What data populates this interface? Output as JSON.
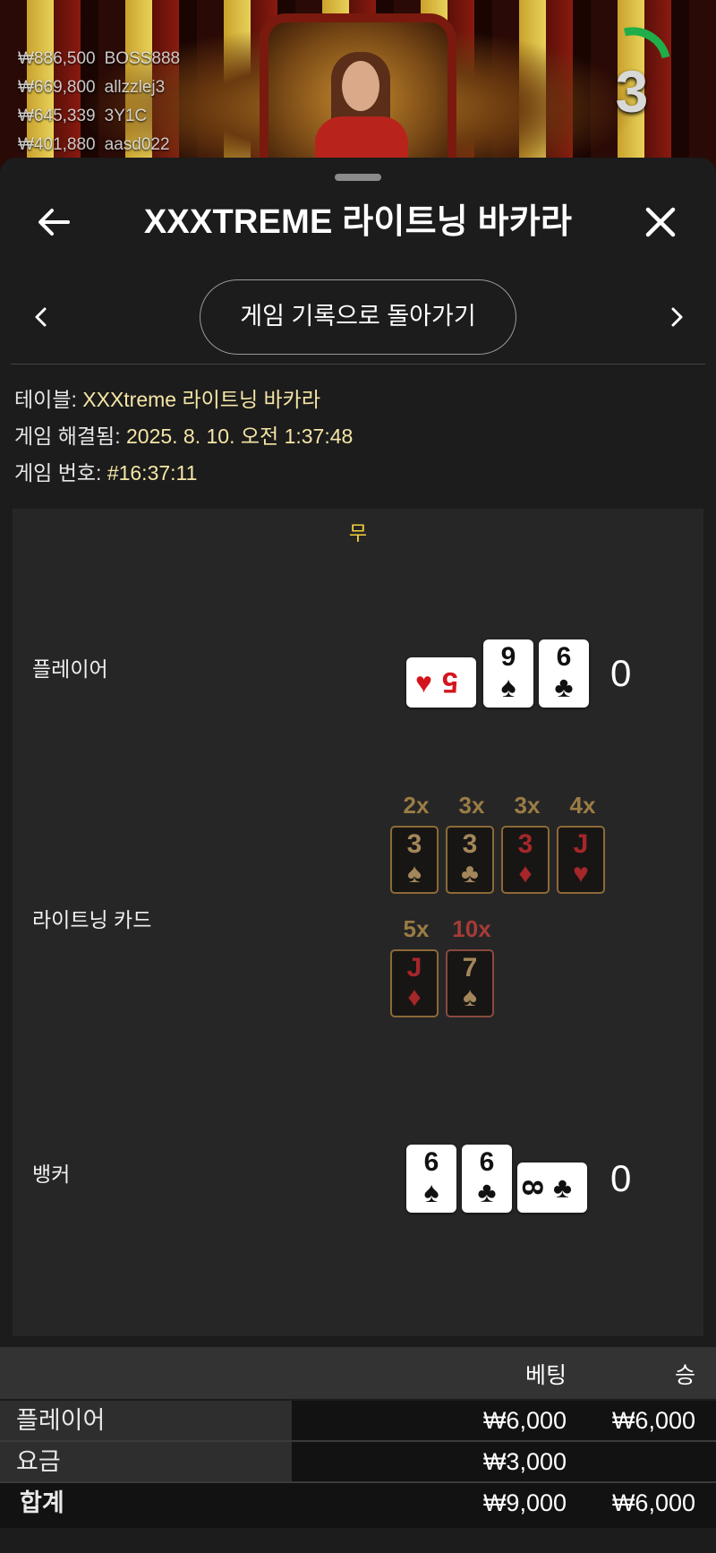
{
  "live_feed": {
    "winners": [
      {
        "amount": "₩886,500",
        "user": "BOSS888"
      },
      {
        "amount": "₩669,800",
        "user": "allzzlej3"
      },
      {
        "amount": "₩645,339",
        "user": "3Y1C"
      },
      {
        "amount": "₩401,880",
        "user": "aasd022"
      }
    ],
    "timer": "3",
    "timer_color": "#1fae4a"
  },
  "header": {
    "title": "XXXTREME 라이트닝 바카라",
    "back_icon": "arrow-left-icon",
    "close_icon": "close-icon"
  },
  "nav": {
    "history_button": "게임 기록으로 돌아가기",
    "prev_icon": "chevron-left-icon",
    "next_icon": "chevron-right-icon"
  },
  "meta": {
    "table_label": "테이블:",
    "table_value": "XXXtreme 라이트닝 바카라",
    "resolved_label": "게임 해결됨:",
    "resolved_value": "2025. 8. 10. 오전 1:37:48",
    "game_no_label": "게임 번호:",
    "game_no_value": "#16:37:11"
  },
  "result": {
    "outcome": "무",
    "player": {
      "label": "플레이어",
      "total": "0",
      "cards": [
        {
          "rank": "5",
          "suit": "♥",
          "color": "red",
          "orientation": "sideways"
        },
        {
          "rank": "9",
          "suit": "♠",
          "color": "black"
        },
        {
          "rank": "6",
          "suit": "♣",
          "color": "black"
        }
      ]
    },
    "lightning": {
      "label": "라이트닝 카드",
      "cards": [
        {
          "rank": "3",
          "suit": "♠",
          "multiplier": "2x"
        },
        {
          "rank": "3",
          "suit": "♣",
          "multiplier": "3x"
        },
        {
          "rank": "3",
          "suit": "♦",
          "multiplier": "3x"
        },
        {
          "rank": "J",
          "suit": "♥",
          "multiplier": "4x"
        },
        {
          "rank": "J",
          "suit": "♦",
          "multiplier": "5x"
        },
        {
          "rank": "7",
          "suit": "♠",
          "multiplier": "10x"
        }
      ]
    },
    "banker": {
      "label": "뱅커",
      "total": "0",
      "cards": [
        {
          "rank": "6",
          "suit": "♠",
          "color": "black"
        },
        {
          "rank": "6",
          "suit": "♣",
          "color": "black"
        },
        {
          "rank": "8",
          "suit": "♣",
          "color": "black",
          "orientation": "sideways"
        }
      ]
    }
  },
  "bets": {
    "col_bet": "베팅",
    "col_win": "승",
    "rows": [
      {
        "name": "플레이어",
        "bet": "₩6,000",
        "win": "₩6,000"
      },
      {
        "name": "요금",
        "bet": "₩3,000",
        "win": ""
      }
    ],
    "total": {
      "name": "합계",
      "bet": "₩9,000",
      "win": "₩6,000"
    }
  }
}
